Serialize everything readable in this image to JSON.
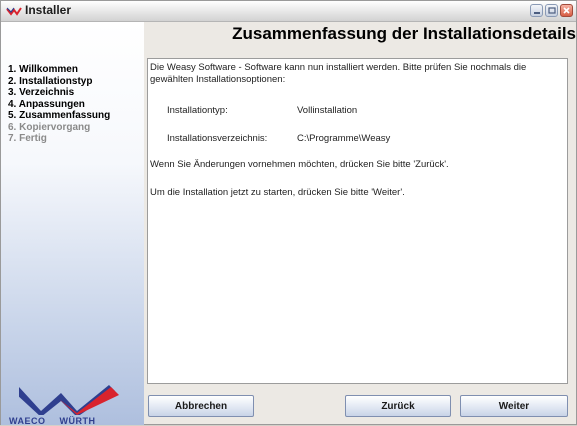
{
  "window": {
    "title": "Installer"
  },
  "sidebar": {
    "steps": [
      {
        "label": "1. Willkommen",
        "state": "done"
      },
      {
        "label": "2. Installationstyp",
        "state": "done"
      },
      {
        "label": "3. Verzeichnis",
        "state": "done"
      },
      {
        "label": "4. Anpassungen",
        "state": "done"
      },
      {
        "label": "5. Zusammenfassung",
        "state": "current"
      },
      {
        "label": "6. Kopiervorgang",
        "state": "pending"
      },
      {
        "label": "7. Fertig",
        "state": "pending"
      }
    ],
    "logo_text_left": "WAECO",
    "logo_text_right": "WÜRTH"
  },
  "main": {
    "title": "Zusammenfassung der Installationsdetails",
    "intro": "Die Weasy Software - Software kann nun installiert werden. Bitte prüfen Sie nochmals die gewählten Installationsoptionen:",
    "details": [
      {
        "label": "Installationtyp:",
        "value": "Vollinstallation"
      },
      {
        "label": "Installationsverzeichnis:",
        "value": "C:\\Programme\\Weasy"
      }
    ],
    "change_hint": "Wenn Sie Änderungen vornehmen möchten, drücken Sie bitte 'Zurück'.",
    "start_hint": "Um die Installation jetzt zu starten, drücken Sie bitte 'Weiter'."
  },
  "buttons": {
    "cancel": "Abbrechen",
    "back": "Zurück",
    "next": "Weiter"
  },
  "colors": {
    "logo_red": "#d9232d",
    "logo_blue": "#2f3f8f"
  }
}
